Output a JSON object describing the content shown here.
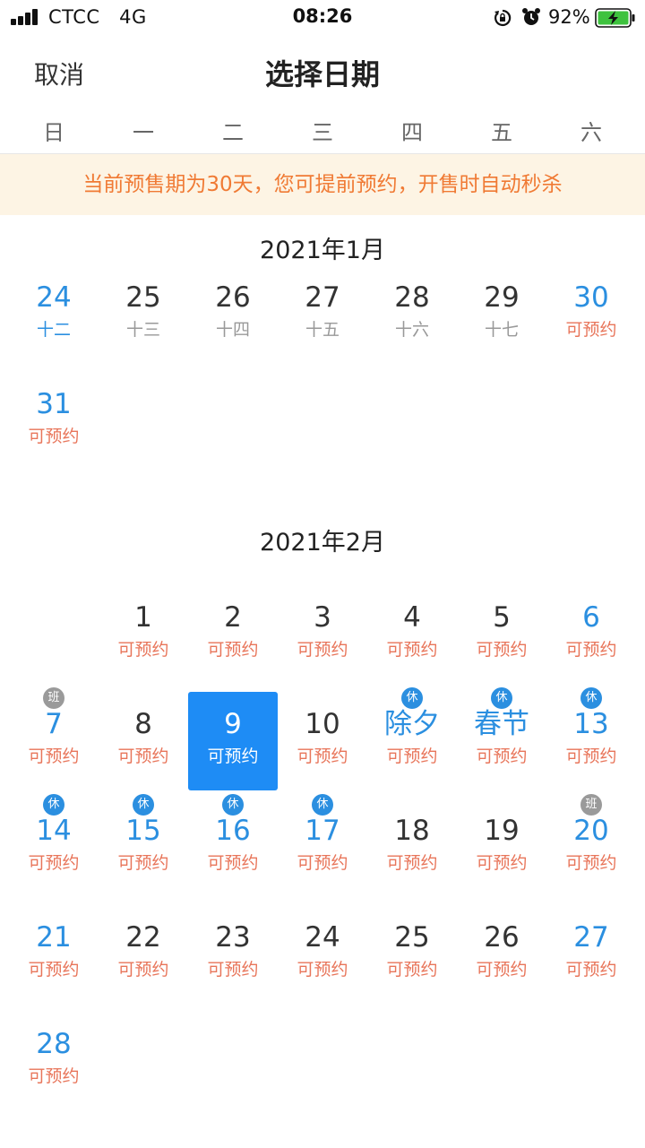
{
  "status_bar": {
    "carrier": "CTCC",
    "network": "4G",
    "time": "08:26",
    "battery": "92%",
    "icons": [
      "signal-icon",
      "rotation-lock-icon",
      "alarm-icon",
      "battery-charging-icon"
    ]
  },
  "nav": {
    "cancel": "取消",
    "title": "选择日期"
  },
  "weekdays": [
    "日",
    "一",
    "二",
    "三",
    "四",
    "五",
    "六"
  ],
  "notice": "当前预售期为30天，您可提前预约，开售时自动秒杀",
  "colors": {
    "accent": "#1e8cf5",
    "weekend": "#2b8fe0",
    "available": "#e8755a",
    "notice_bg": "#fdf4e4",
    "notice_text": "#f07a34"
  },
  "months": [
    {
      "title": "2021年1月",
      "start_weekday": 0,
      "days": [
        {
          "d": "24",
          "sub": "十二",
          "state": "lunar"
        },
        {
          "d": "25",
          "sub": "十三",
          "state": "lunar"
        },
        {
          "d": "26",
          "sub": "十四",
          "state": "lunar"
        },
        {
          "d": "27",
          "sub": "十五",
          "state": "lunar"
        },
        {
          "d": "28",
          "sub": "十六",
          "state": "lunar"
        },
        {
          "d": "29",
          "sub": "十七",
          "state": "lunar"
        },
        {
          "d": "30",
          "sub": "可预约",
          "state": "avail"
        },
        {
          "d": "31",
          "sub": "可预约",
          "state": "avail"
        }
      ]
    },
    {
      "title": "2021年2月",
      "start_weekday": 1,
      "days": [
        {
          "d": "1",
          "sub": "可预约",
          "state": "avail"
        },
        {
          "d": "2",
          "sub": "可预约",
          "state": "avail"
        },
        {
          "d": "3",
          "sub": "可预约",
          "state": "avail"
        },
        {
          "d": "4",
          "sub": "可预约",
          "state": "avail"
        },
        {
          "d": "5",
          "sub": "可预约",
          "state": "avail"
        },
        {
          "d": "6",
          "sub": "可预约",
          "state": "avail"
        },
        {
          "d": "7",
          "sub": "可预约",
          "state": "avail",
          "badge": "班"
        },
        {
          "d": "8",
          "sub": "可预约",
          "state": "avail"
        },
        {
          "d": "9",
          "sub": "可预约",
          "state": "avail",
          "selected": true
        },
        {
          "d": "10",
          "sub": "可预约",
          "state": "avail"
        },
        {
          "d": "除夕",
          "sub": "可预约",
          "state": "avail",
          "badge": "休",
          "holiday": true
        },
        {
          "d": "春节",
          "sub": "可预约",
          "state": "avail",
          "badge": "休",
          "holiday": true
        },
        {
          "d": "13",
          "sub": "可预约",
          "state": "avail",
          "badge": "休",
          "holiday": true
        },
        {
          "d": "14",
          "sub": "可预约",
          "state": "avail",
          "badge": "休",
          "holiday": true
        },
        {
          "d": "15",
          "sub": "可预约",
          "state": "avail",
          "badge": "休",
          "holiday": true
        },
        {
          "d": "16",
          "sub": "可预约",
          "state": "avail",
          "badge": "休",
          "holiday": true
        },
        {
          "d": "17",
          "sub": "可预约",
          "state": "avail",
          "badge": "休",
          "holiday": true
        },
        {
          "d": "18",
          "sub": "可预约",
          "state": "avail"
        },
        {
          "d": "19",
          "sub": "可预约",
          "state": "avail"
        },
        {
          "d": "20",
          "sub": "可预约",
          "state": "avail",
          "badge": "班"
        },
        {
          "d": "21",
          "sub": "可预约",
          "state": "avail"
        },
        {
          "d": "22",
          "sub": "可预约",
          "state": "avail"
        },
        {
          "d": "23",
          "sub": "可预约",
          "state": "avail"
        },
        {
          "d": "24",
          "sub": "可预约",
          "state": "avail"
        },
        {
          "d": "25",
          "sub": "可预约",
          "state": "avail"
        },
        {
          "d": "26",
          "sub": "可预约",
          "state": "avail"
        },
        {
          "d": "27",
          "sub": "可预约",
          "state": "avail"
        },
        {
          "d": "28",
          "sub": "可预约",
          "state": "avail"
        }
      ]
    }
  ]
}
